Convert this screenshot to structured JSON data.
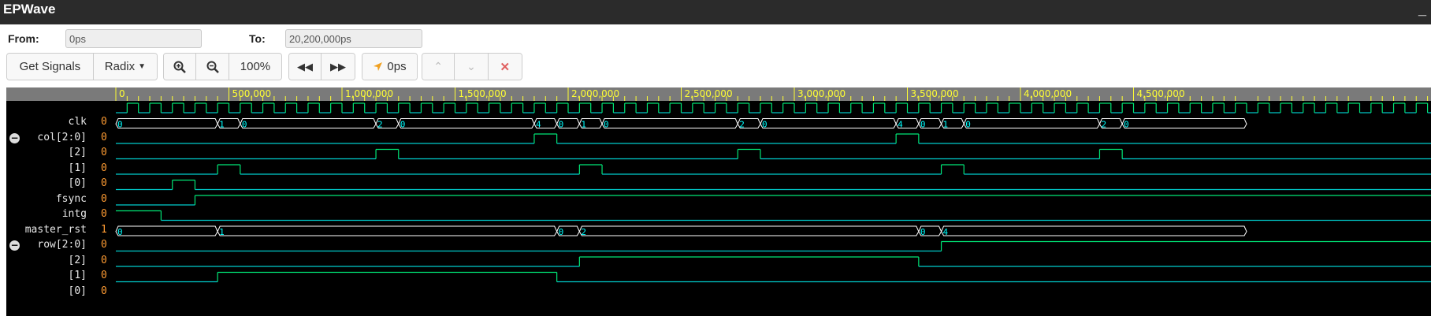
{
  "app": {
    "title": "EPWave"
  },
  "range": {
    "from_label": "From:",
    "from_value": "0ps",
    "to_label": "To:",
    "to_value": "20,200,000ps"
  },
  "toolbar": {
    "get_signals": "Get Signals",
    "radix": "Radix",
    "zoom_level": "100%",
    "cursor_time": "0ps"
  },
  "colors": {
    "signal": "#00e676",
    "zero": "#00cccc",
    "bus": "#00ffff",
    "value": "#ff9c33",
    "ruler_text": "#ffff33"
  },
  "ruler": {
    "labels": [
      "0",
      "500,000",
      "1,000,000",
      "1,500,000",
      "2,000,000",
      "2,500,000",
      "3,000,000",
      "3,500,000",
      "4,000,000",
      "4,500,000"
    ],
    "major_step_ps": 500000
  },
  "signals": [
    {
      "name": "clk",
      "value": "0",
      "type": "clock",
      "period_ps": 100000,
      "first_rise_ps": 50000
    },
    {
      "name": "col[2:0]",
      "value": "0",
      "type": "bus",
      "collapsible": true,
      "segments": [
        {
          "start": 0,
          "end": 450000,
          "label": "0"
        },
        {
          "start": 450000,
          "end": 550000,
          "label": "1"
        },
        {
          "start": 550000,
          "end": 1150000,
          "label": "0"
        },
        {
          "start": 1150000,
          "end": 1250000,
          "label": "2"
        },
        {
          "start": 1250000,
          "end": 1850000,
          "label": "0"
        },
        {
          "start": 1850000,
          "end": 1950000,
          "label": "4"
        },
        {
          "start": 1950000,
          "end": 2050000,
          "label": "0"
        },
        {
          "start": 2050000,
          "end": 2150000,
          "label": "1"
        },
        {
          "start": 2150000,
          "end": 2750000,
          "label": "0"
        },
        {
          "start": 2750000,
          "end": 2850000,
          "label": "2"
        },
        {
          "start": 2850000,
          "end": 3450000,
          "label": "0"
        },
        {
          "start": 3450000,
          "end": 3550000,
          "label": "4"
        },
        {
          "start": 3550000,
          "end": 3650000,
          "label": "0"
        },
        {
          "start": 3650000,
          "end": 3750000,
          "label": "1"
        },
        {
          "start": 3750000,
          "end": 4350000,
          "label": "0"
        },
        {
          "start": 4350000,
          "end": 4450000,
          "label": "2"
        },
        {
          "start": 4450000,
          "end": 5000000,
          "label": "0"
        }
      ]
    },
    {
      "name": "[2]",
      "value": "0",
      "type": "bit",
      "edges": [
        [
          0,
          0
        ],
        [
          1850000,
          1
        ],
        [
          1950000,
          0
        ],
        [
          3450000,
          1
        ],
        [
          3550000,
          0
        ]
      ]
    },
    {
      "name": "[1]",
      "value": "0",
      "type": "bit",
      "edges": [
        [
          0,
          0
        ],
        [
          1150000,
          1
        ],
        [
          1250000,
          0
        ],
        [
          2750000,
          1
        ],
        [
          2850000,
          0
        ],
        [
          4350000,
          1
        ],
        [
          4450000,
          0
        ]
      ]
    },
    {
      "name": "[0]",
      "value": "0",
      "type": "bit",
      "edges": [
        [
          0,
          0
        ],
        [
          450000,
          1
        ],
        [
          550000,
          0
        ],
        [
          2050000,
          1
        ],
        [
          2150000,
          0
        ],
        [
          3650000,
          1
        ],
        [
          3750000,
          0
        ]
      ]
    },
    {
      "name": "fsync",
      "value": "0",
      "type": "bit",
      "edges": [
        [
          0,
          0
        ],
        [
          250000,
          1
        ],
        [
          350000,
          0
        ]
      ]
    },
    {
      "name": "intg",
      "value": "0",
      "type": "bit",
      "edges": [
        [
          0,
          0
        ],
        [
          350000,
          1
        ]
      ]
    },
    {
      "name": "master_rst",
      "value": "1",
      "type": "bit",
      "edges": [
        [
          0,
          1
        ],
        [
          200000,
          0
        ]
      ]
    },
    {
      "name": "row[2:0]",
      "value": "0",
      "type": "bus",
      "collapsible": true,
      "segments": [
        {
          "start": 0,
          "end": 450000,
          "label": "0"
        },
        {
          "start": 450000,
          "end": 1950000,
          "label": "1"
        },
        {
          "start": 1950000,
          "end": 2050000,
          "label": "0"
        },
        {
          "start": 2050000,
          "end": 3550000,
          "label": "2"
        },
        {
          "start": 3550000,
          "end": 3650000,
          "label": "0"
        },
        {
          "start": 3650000,
          "end": 5000000,
          "label": "4"
        }
      ]
    },
    {
      "name": "[2]",
      "value": "0",
      "type": "bit",
      "edges": [
        [
          0,
          0
        ],
        [
          3650000,
          1
        ]
      ]
    },
    {
      "name": "[1]",
      "value": "0",
      "type": "bit",
      "edges": [
        [
          0,
          0
        ],
        [
          2050000,
          1
        ],
        [
          3550000,
          0
        ]
      ]
    },
    {
      "name": "[0]",
      "value": "0",
      "type": "bit",
      "edges": [
        [
          0,
          0
        ],
        [
          450000,
          1
        ],
        [
          1950000,
          0
        ]
      ]
    }
  ]
}
